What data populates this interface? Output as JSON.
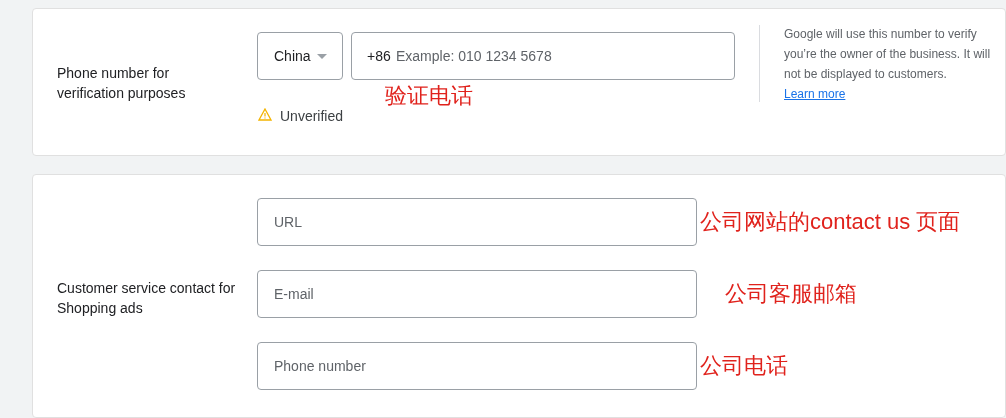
{
  "verification": {
    "label": "Phone number for verification purposes",
    "country": {
      "value": "China"
    },
    "phone": {
      "prefix": "+86",
      "placeholder": "Example: 010 1234 5678"
    },
    "status": "Unverified",
    "annotation": "验证电话",
    "help_lines": [
      "Google will use this number to verify",
      "you’re the owner of the business. It will",
      "not be displayed to customers."
    ],
    "learn_more": "Learn more"
  },
  "customer_service": {
    "label": "Customer service contact for Shopping ads",
    "fields": [
      {
        "placeholder": "URL",
        "annotation": "公司网站的contact us 页面"
      },
      {
        "placeholder": "E-mail",
        "annotation": "公司客服邮箱"
      },
      {
        "placeholder": "Phone number",
        "annotation": "公司电话"
      }
    ]
  }
}
